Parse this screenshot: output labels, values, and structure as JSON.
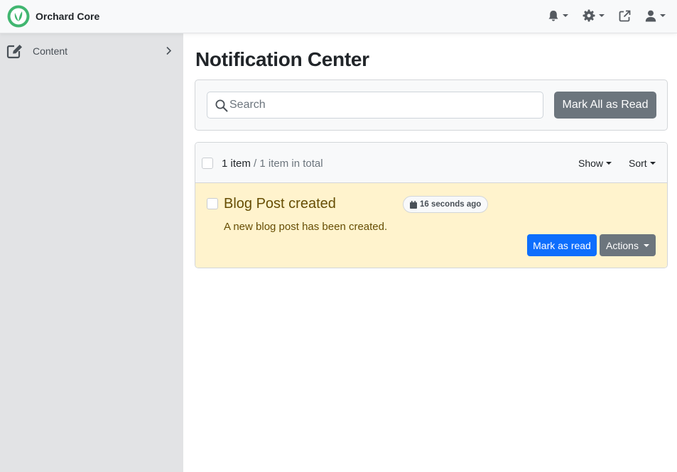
{
  "navbar": {
    "brand": "Orchard Core",
    "tools": [
      "bell-icon",
      "gear-icon",
      "external-link-icon",
      "user-icon"
    ]
  },
  "sidebar": {
    "items": [
      {
        "label": "Content",
        "icon": "edit-icon"
      }
    ]
  },
  "main": {
    "title": "Notification Center",
    "search": {
      "placeholder": "Search",
      "value": ""
    },
    "mark_all_label": "Mark All as Read",
    "list": {
      "count_label": "1 item",
      "total_label": "/ 1 item in total",
      "show_label": "Show",
      "sort_label": "Sort",
      "notifications": [
        {
          "title": "Blog Post created",
          "time": "16 seconds ago",
          "body": "A new blog post has been created.",
          "mark_read_label": "Mark as read",
          "actions_label": "Actions"
        }
      ]
    }
  },
  "colors": {
    "navbar_bg": "#f8f9fa",
    "sidebar_bg": "#e2e3e5",
    "brand_green": "#41b670",
    "primary": "#0d6efd",
    "secondary": "#6c757d",
    "warning_bg": "#fff3cd",
    "warning_text": "#664d03"
  }
}
